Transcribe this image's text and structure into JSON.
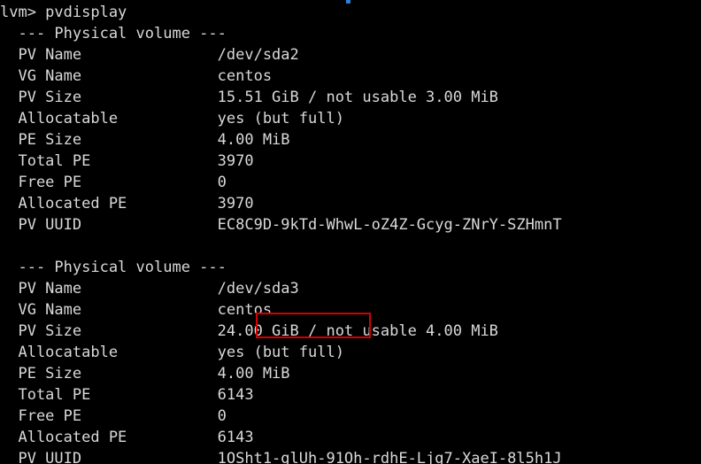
{
  "terminal": {
    "colors": {
      "background": "#000000",
      "foreground": "#d9d9d9",
      "annotation_red": "#d40000",
      "artifact_blue": "#2f7fd4"
    },
    "prompt_line": "lvm> pvdisplay",
    "blocks": [
      {
        "header": "  --- Physical volume ---",
        "rows": [
          {
            "label": "  PV Name",
            "value": "/dev/sda2"
          },
          {
            "label": "  VG Name",
            "value": "centos"
          },
          {
            "label": "  PV Size",
            "value": "15.51 GiB / not usable 3.00 MiB"
          },
          {
            "label": "  Allocatable",
            "value": "yes (but full)"
          },
          {
            "label": "  PE Size",
            "value": "4.00 MiB"
          },
          {
            "label": "  Total PE",
            "value": "3970"
          },
          {
            "label": "  Free PE",
            "value": "0"
          },
          {
            "label": "  Allocated PE",
            "value": "3970"
          },
          {
            "label": "  PV UUID",
            "value": "EC8C9D-9kTd-WhwL-oZ4Z-Gcyg-ZNrY-SZHmnT"
          }
        ]
      },
      {
        "header": "  --- Physical volume ---",
        "rows": [
          {
            "label": "  PV Name",
            "value": "/dev/sda3"
          },
          {
            "label": "  VG Name",
            "value": "centos"
          },
          {
            "label": "  PV Size",
            "value": "24.00 GiB / not usable 4.00 MiB"
          },
          {
            "label": "  Allocatable",
            "value": "yes (but full)"
          },
          {
            "label": "  PE Size",
            "value": "4.00 MiB"
          },
          {
            "label": "  Total PE",
            "value": "6143"
          },
          {
            "label": "  Free PE",
            "value": "0"
          },
          {
            "label": "  Allocated PE",
            "value": "6143"
          },
          {
            "label": "  PV UUID",
            "value": "1OSht1-glUh-91Oh-rdhE-Ljg7-XaeI-8l5h1J"
          }
        ]
      }
    ],
    "annotation": {
      "highlighted_text": "24.00 GiB"
    }
  }
}
